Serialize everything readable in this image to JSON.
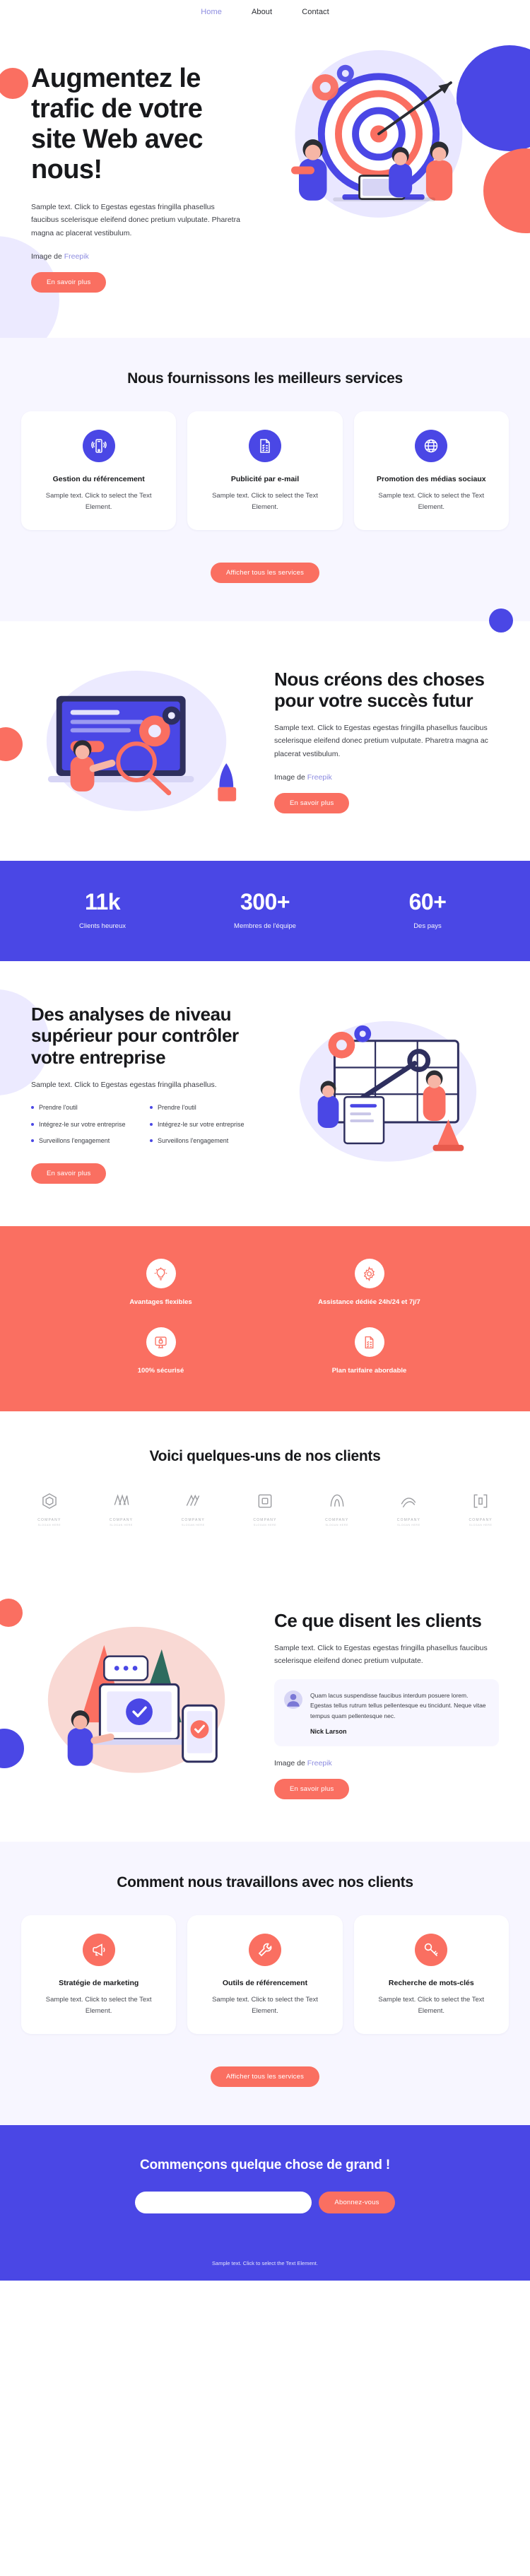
{
  "nav": {
    "items": [
      {
        "label": "Home",
        "active": true
      },
      {
        "label": "About",
        "active": false
      },
      {
        "label": "Contact",
        "active": false
      }
    ]
  },
  "hero": {
    "title": "Augmentez le trafic de votre site Web avec nous!",
    "body": "Sample text. Click to Egestas egestas fringilla phasellus faucibus scelerisque eleifend donec pretium vulputate. Pharetra magna ac placerat vestibulum.",
    "credit_prefix": "Image de ",
    "credit_link": "Freepik",
    "cta": "En savoir plus"
  },
  "services": {
    "title": "Nous fournissons les meilleurs services",
    "cards": [
      {
        "icon": "mobile-signal-icon",
        "title": "Gestion du référencement",
        "text": "Sample text. Click to select the Text Element."
      },
      {
        "icon": "document-checklist-icon",
        "title": "Publicité par e-mail",
        "text": "Sample text. Click to select the Text Element."
      },
      {
        "icon": "globe-icon",
        "title": "Promotion des médias sociaux",
        "text": "Sample text. Click to select the Text Element."
      }
    ],
    "cta": "Afficher tous les services"
  },
  "create": {
    "title": "Nous créons des choses pour votre succès futur",
    "body": "Sample text. Click to Egestas egestas fringilla phasellus faucibus scelerisque eleifend donec pretium vulputate. Pharetra magna ac placerat vestibulum.",
    "credit_prefix": "Image de ",
    "credit_link": "Freepik",
    "cta": "En savoir plus"
  },
  "stats": {
    "items": [
      {
        "value": "11k",
        "label": "Clients heureux"
      },
      {
        "value": "300+",
        "label": "Membres de l'équipe"
      },
      {
        "value": "60+",
        "label": "Des pays"
      }
    ]
  },
  "analytics": {
    "title": "Des analyses de niveau supérieur pour contrôler votre entreprise",
    "body": "Sample text. Click to Egestas egestas fringilla phasellus.",
    "bullets_left": [
      "Prendre l'outil",
      "Intégrez-le sur votre entreprise",
      "Surveillons l'engagement"
    ],
    "bullets_right": [
      "Prendre l'outil",
      "Intégrez-le sur votre entreprise",
      "Surveillons l'engagement"
    ],
    "cta": "En savoir plus"
  },
  "features": {
    "items": [
      {
        "icon": "lightbulb-icon",
        "label": "Avantages flexibles"
      },
      {
        "icon": "gear-icon",
        "label": "Assistance dédiée 24h/24 et 7j/7"
      },
      {
        "icon": "lock-screen-icon",
        "label": "100% sécurisé"
      },
      {
        "icon": "price-list-icon",
        "label": "Plan tarifaire abordable"
      }
    ]
  },
  "clients": {
    "title": "Voici quelques-uns de nos clients",
    "logos": [
      {
        "name": "COMPANY",
        "sub": "SLOGAN HERE"
      },
      {
        "name": "COMPANY",
        "sub": "SLOGAN HERE"
      },
      {
        "name": "COMPANY",
        "sub": "SLOGAN HERE"
      },
      {
        "name": "COMPANY",
        "sub": "SLOGAN HERE"
      },
      {
        "name": "COMPANY",
        "sub": "SLOGAN HERE"
      },
      {
        "name": "COMPANY",
        "sub": "SLOGAN HERE"
      },
      {
        "name": "COMPANY",
        "sub": "SLOGAN HERE"
      }
    ]
  },
  "testimonials": {
    "title": "Ce que disent les clients",
    "body": "Sample text. Click to Egestas egestas fringilla phasellus faucibus scelerisque eleifend donec pretium vulputate.",
    "quote": "Quam lacus suspendisse faucibus interdum posuere lorem. Egestas tellus rutrum tellus pellentesque eu tincidunt. Neque vitae tempus quam pellentesque nec.",
    "author": "Nick Larson",
    "credit_prefix": "Image de ",
    "credit_link": "Freepik",
    "cta": "En savoir plus"
  },
  "process": {
    "title": "Comment nous travaillons avec nos clients",
    "cards": [
      {
        "icon": "megaphone-icon",
        "title": "Stratégie de marketing",
        "text": "Sample text. Click to select the Text Element."
      },
      {
        "icon": "wrench-icon",
        "title": "Outils de référencement",
        "text": "Sample text. Click to select the Text Element."
      },
      {
        "icon": "key-icon",
        "title": "Recherche de mots-clés",
        "text": "Sample text. Click to select the Text Element."
      }
    ],
    "cta": "Afficher tous les services"
  },
  "cta": {
    "title": "Commençons quelque chose de grand !",
    "placeholder": "",
    "value": "",
    "button": "Abonnez-vous",
    "note": "Sample text. Click to select the Text Element."
  },
  "colors": {
    "brand_blue": "#4a47e5",
    "brand_coral": "#fa6f61",
    "lavender": "#f7f6ff",
    "link": "#8d8ce0"
  }
}
